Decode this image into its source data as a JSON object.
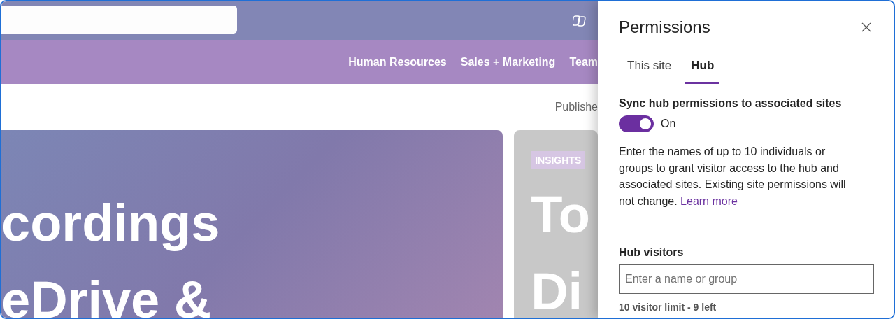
{
  "site": {
    "nav_links": [
      {
        "label": "Human Resources"
      },
      {
        "label": "Sales + Marketing"
      },
      {
        "label": "Team"
      }
    ],
    "published_label": "Publishe",
    "cards": [
      {
        "kind": "hero",
        "lines": [
          "cordings",
          "eDrive &"
        ]
      },
      {
        "kind": "tagged",
        "tag": "INSIGHTS",
        "lines": [
          "To",
          "Di"
        ]
      }
    ]
  },
  "panel": {
    "title": "Permissions",
    "tabs": [
      {
        "label": "This site",
        "selected": false
      },
      {
        "label": "Hub",
        "selected": true
      }
    ],
    "sync": {
      "label": "Sync hub permissions to associated sites",
      "on": true,
      "state_text": "On"
    },
    "description": "Enter the names of up to 10 individuals or groups to grant visitor access to the hub and associated sites. Existing site permissions will not change.",
    "learn_more": "Learn more",
    "visitors": {
      "label": "Hub visitors",
      "placeholder": "Enter a name or group",
      "hint": "10 visitor limit - 9 left"
    }
  }
}
